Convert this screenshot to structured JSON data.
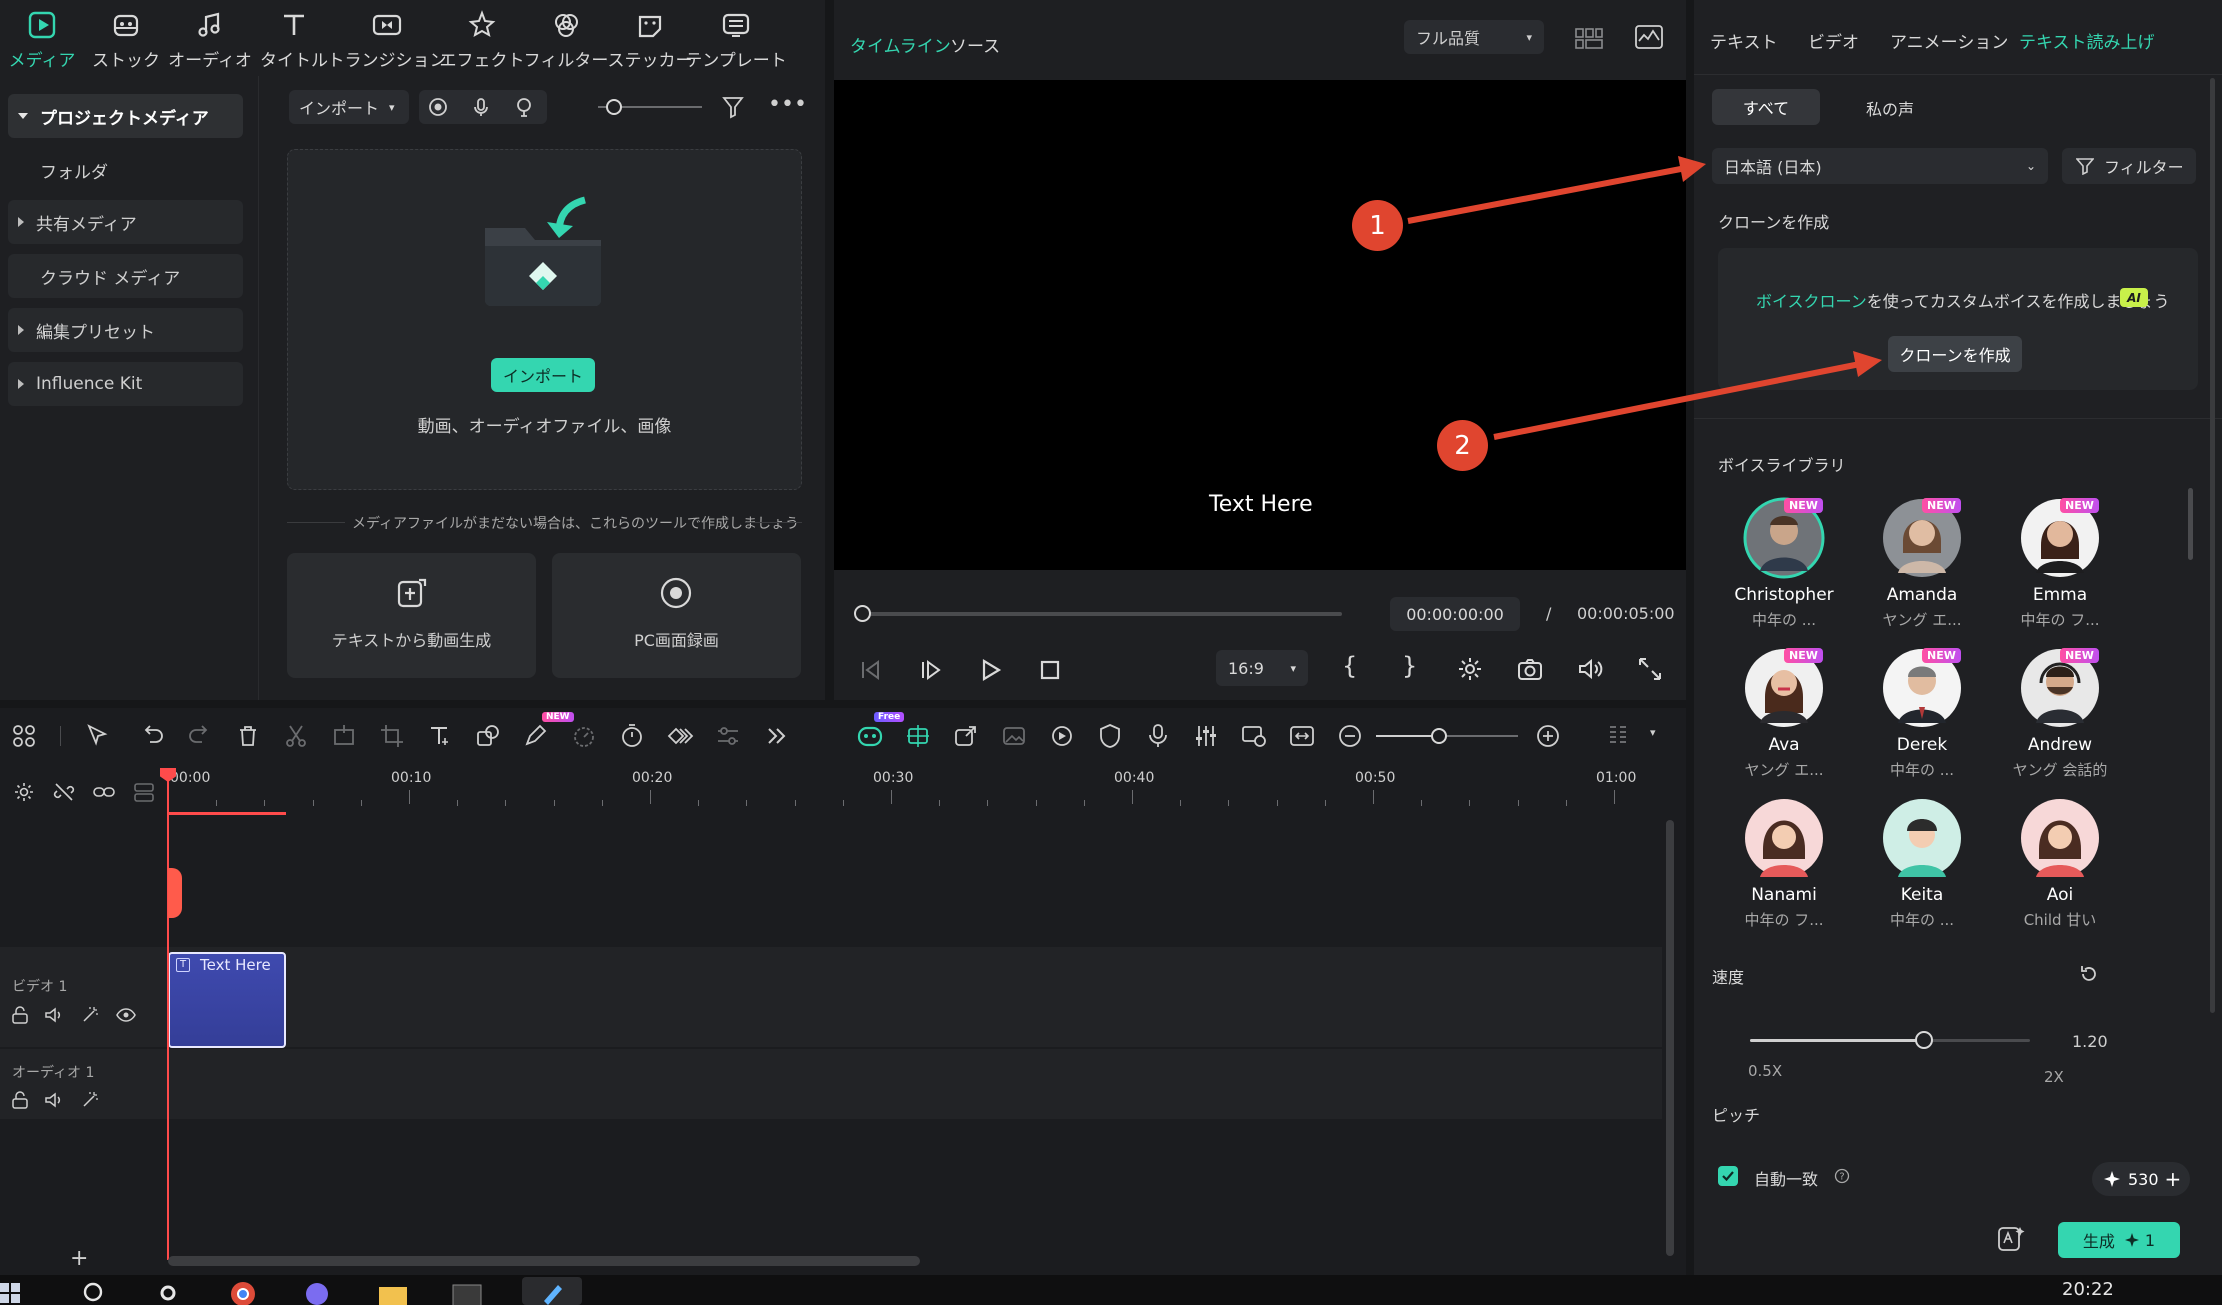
{
  "media_tabs": [
    {
      "label": "メディア",
      "icon": "media-icon",
      "active": true
    },
    {
      "label": "ストック",
      "icon": "stock-icon"
    },
    {
      "label": "オーディオ",
      "icon": "audio-icon"
    },
    {
      "label": "タイトル",
      "icon": "title-icon"
    },
    {
      "label": "トランジション",
      "icon": "transition-icon"
    },
    {
      "label": "エフェクト",
      "icon": "effect-icon"
    },
    {
      "label": "フィルター",
      "icon": "filter-icon"
    },
    {
      "label": "ステッカー",
      "icon": "sticker-icon"
    },
    {
      "label": "テンプレート",
      "icon": "template-icon"
    }
  ],
  "sidebar": {
    "items": [
      {
        "label": "プロジェクトメディア"
      },
      {
        "label": "フォルダ"
      },
      {
        "label": "共有メディア"
      },
      {
        "label": "クラウド メディア"
      },
      {
        "label": "編集プリセット"
      },
      {
        "label": "Influence Kit"
      }
    ]
  },
  "media": {
    "import_dropdown": "インポート",
    "import_button": "インポート",
    "import_hint": "動画、オーディオファイル、画像",
    "empty_hint": "メディアファイルがまだない場合は、これらのツールで作成しましょう",
    "tool_text_to_video": "テキストから動画生成",
    "tool_screen_record": "PC画面録画"
  },
  "player": {
    "tab_timeline": "タイムライン",
    "tab_source": "ソース",
    "quality": "フル品質",
    "overlay_text": "Text Here",
    "current_time": "00:00:00:00",
    "separator": "/",
    "total_time": "00:00:05:00",
    "aspect": "16:9",
    "brace_open": "{",
    "brace_close": "}"
  },
  "right_panel": {
    "tabs": [
      "テキスト",
      "ビデオ",
      "アニメーション",
      "テキスト読み上げ"
    ],
    "active_tab": 3,
    "subtabs": [
      "すべて",
      "私の声"
    ],
    "language": "日本語 (日本)",
    "filter": "フィルター",
    "clone_section": "クローンを作成",
    "clone_promo_highlight": "ボイスクローン",
    "clone_promo_rest": "を使ってカスタムボイスを作成しましょう",
    "ai_badge": "AI",
    "clone_button": "クローンを作成",
    "library_title": "ボイスライブラリ",
    "new_badge": "NEW",
    "voices": [
      {
        "name": "Christopher",
        "desc": "中年の ..."
      },
      {
        "name": "Amanda",
        "desc": "ヤング エ..."
      },
      {
        "name": "Emma",
        "desc": "中年の フ..."
      },
      {
        "name": "Ava",
        "desc": "ヤング エ..."
      },
      {
        "name": "Derek",
        "desc": "中年の ..."
      },
      {
        "name": "Andrew",
        "desc": "ヤング 会話的"
      },
      {
        "name": "Nanami",
        "desc": "中年の フ..."
      },
      {
        "name": "Keita",
        "desc": "中年の ..."
      },
      {
        "name": "Aoi",
        "desc": "Child 甘い"
      }
    ],
    "speed_label": "速度",
    "speed_value": "1.20",
    "speed_min": "0.5X",
    "speed_max": "2X",
    "speed_fraction": 0.62,
    "pitch_label": "ピッチ",
    "auto_match": "自動一致",
    "credits": "530",
    "generate": "生成",
    "generate_cost": "1"
  },
  "timeline": {
    "ruler": [
      "00:00",
      "00:10",
      "00:20",
      "00:30",
      "00:40",
      "00:50",
      "01:00"
    ],
    "clip_label": "Text Here",
    "track_video": "ビデオ 1",
    "track_audio": "オーディオ 1",
    "free_badge": "Free",
    "new_badge": "NEW"
  },
  "annotations": [
    "1",
    "2"
  ],
  "taskbar": {
    "clock": "20:22"
  },
  "colors": {
    "accent": "#34d6b0",
    "annotation": "#e0452f",
    "clip": "#3c46a8",
    "playhead": "#ff4b4b"
  }
}
